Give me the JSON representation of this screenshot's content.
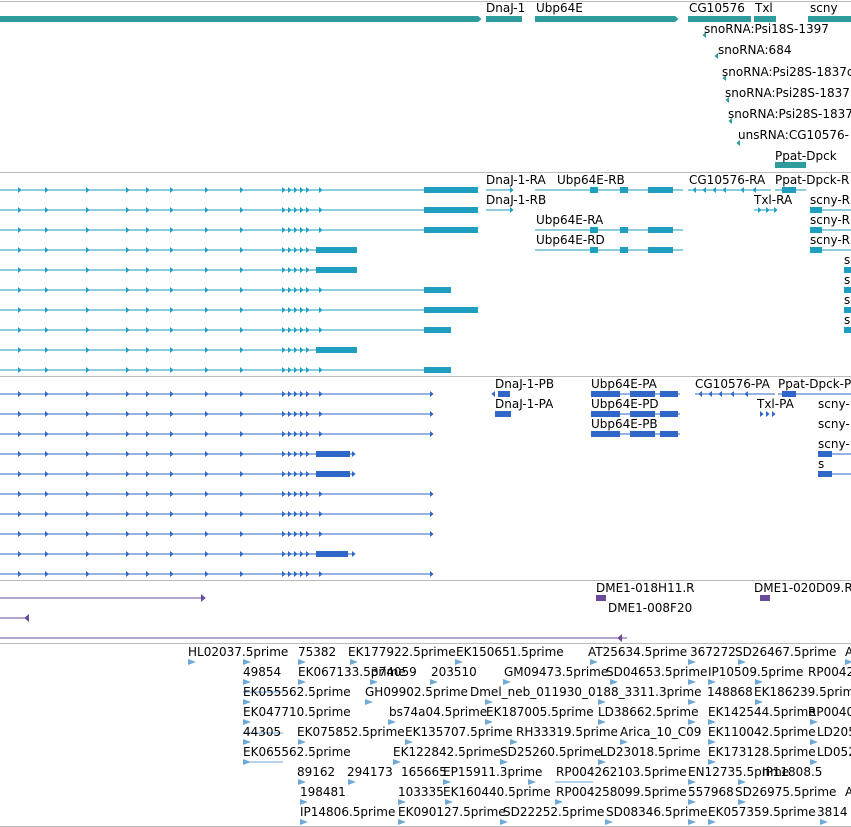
{
  "colors": {
    "gene": "#2e9c9c",
    "transcript": "#1e9fbf",
    "protein": "#2e67c8",
    "clone": "#6a4a9c",
    "est": "#6fa9d8",
    "divider": "#bbbbbb"
  },
  "tracks": {
    "genes": {
      "labels": [
        {
          "text": "DnaJ-1"
        },
        {
          "text": "Ubp64E"
        },
        {
          "text": "CG10576"
        },
        {
          "text": "Txl"
        },
        {
          "text": "scny"
        },
        {
          "text": "snoRNA:Psi18S-1397"
        },
        {
          "text": "snoRNA:684"
        },
        {
          "text": "snoRNA:Psi28S-1837c"
        },
        {
          "text": "snoRNA:Psi28S-1837"
        },
        {
          "text": "snoRNA:Psi28S-1837"
        },
        {
          "text": "unsRNA:CG10576-"
        },
        {
          "text": "Ppat-Dpck"
        }
      ]
    },
    "transcripts": {
      "labels": [
        {
          "text": "DnaJ-1-RA"
        },
        {
          "text": "Ubp64E-RB"
        },
        {
          "text": "CG10576-RA"
        },
        {
          "text": "Ppat-Dpck-R"
        },
        {
          "text": "DnaJ-1-RB"
        },
        {
          "text": "Txl-RA"
        },
        {
          "text": "scny-R"
        },
        {
          "text": "Ubp64E-RA"
        },
        {
          "text": "scny-R"
        },
        {
          "text": "Ubp64E-RD"
        },
        {
          "text": "scny-R"
        },
        {
          "text": "s"
        },
        {
          "text": "s"
        },
        {
          "text": "s"
        },
        {
          "text": "s"
        }
      ]
    },
    "proteins": {
      "labels": [
        {
          "text": "DnaJ-1-PB"
        },
        {
          "text": "Ubp64E-PA"
        },
        {
          "text": "CG10576-PA"
        },
        {
          "text": "Ppat-Dpck-P"
        },
        {
          "text": "DnaJ-1-PA"
        },
        {
          "text": "Ubp64E-PD"
        },
        {
          "text": "Txl-PA"
        },
        {
          "text": "scny-"
        },
        {
          "text": "scny-"
        },
        {
          "text": "Ubp64E-PB"
        },
        {
          "text": "scny-"
        },
        {
          "text": "s"
        }
      ]
    },
    "clones": {
      "labels": [
        {
          "text": "DME1-018H11.R"
        },
        {
          "text": "DME1-020D09.R"
        },
        {
          "text": "DME1-008F20"
        }
      ]
    },
    "ests": {
      "labels": [
        {
          "text": "HL02037.5prime"
        },
        {
          "text": "75382"
        },
        {
          "text": "EK177922.5prime"
        },
        {
          "text": "EK150651.5prime"
        },
        {
          "text": "AT25634.5prime"
        },
        {
          "text": "367272"
        },
        {
          "text": "SD26467.5prime"
        },
        {
          "text": "A"
        },
        {
          "text": "49854"
        },
        {
          "text": "EK067133.5prime"
        },
        {
          "text": "374059"
        },
        {
          "text": "203510"
        },
        {
          "text": "GM09473.5prime"
        },
        {
          "text": "SD04653.5prime"
        },
        {
          "text": "IP10509.5prime"
        },
        {
          "text": "RP0042"
        },
        {
          "text": "EK055562.5prime"
        },
        {
          "text": "GH09902.5prime"
        },
        {
          "text": "Dmel_neb_011930_0188_3311.3prime"
        },
        {
          "text": "148868"
        },
        {
          "text": "EK186239.5prime"
        },
        {
          "text": "EK047710.5prime"
        },
        {
          "text": "bs74a04.5prime"
        },
        {
          "text": "EK187005.5prime"
        },
        {
          "text": "LD38662.5prime"
        },
        {
          "text": "EK142544.5prime"
        },
        {
          "text": "RP0040"
        },
        {
          "text": "44305"
        },
        {
          "text": "EK075852.5prime"
        },
        {
          "text": "EK135707.5prime"
        },
        {
          "text": "RH33319.5prime"
        },
        {
          "text": "Arica_10_C09"
        },
        {
          "text": "EK110042.5prime"
        },
        {
          "text": "LD205"
        },
        {
          "text": "EK065562.5prime"
        },
        {
          "text": "EK122842.5prime"
        },
        {
          "text": "SD25260.5prime"
        },
        {
          "text": "LD23018.5prime"
        },
        {
          "text": "EK173128.5prime"
        },
        {
          "text": "LD052"
        },
        {
          "text": "89162"
        },
        {
          "text": "294173"
        },
        {
          "text": "165665"
        },
        {
          "text": "EP15911.3prime"
        },
        {
          "text": "RP004262103.5prime"
        },
        {
          "text": "EN12735.5prime"
        },
        {
          "text": "IP11808.5"
        },
        {
          "text": "198481"
        },
        {
          "text": "103335"
        },
        {
          "text": "EK160440.5prime"
        },
        {
          "text": "RP004258099.5prime"
        },
        {
          "text": "557968"
        },
        {
          "text": "SD26975.5prime"
        },
        {
          "text": "A"
        },
        {
          "text": "IP14806.5prime"
        },
        {
          "text": "EK090127.5prime"
        },
        {
          "text": "SD22252.5prime"
        },
        {
          "text": "SD08346.5prime"
        },
        {
          "text": "EK057359.5prime"
        },
        {
          "text": "3814"
        }
      ]
    }
  }
}
